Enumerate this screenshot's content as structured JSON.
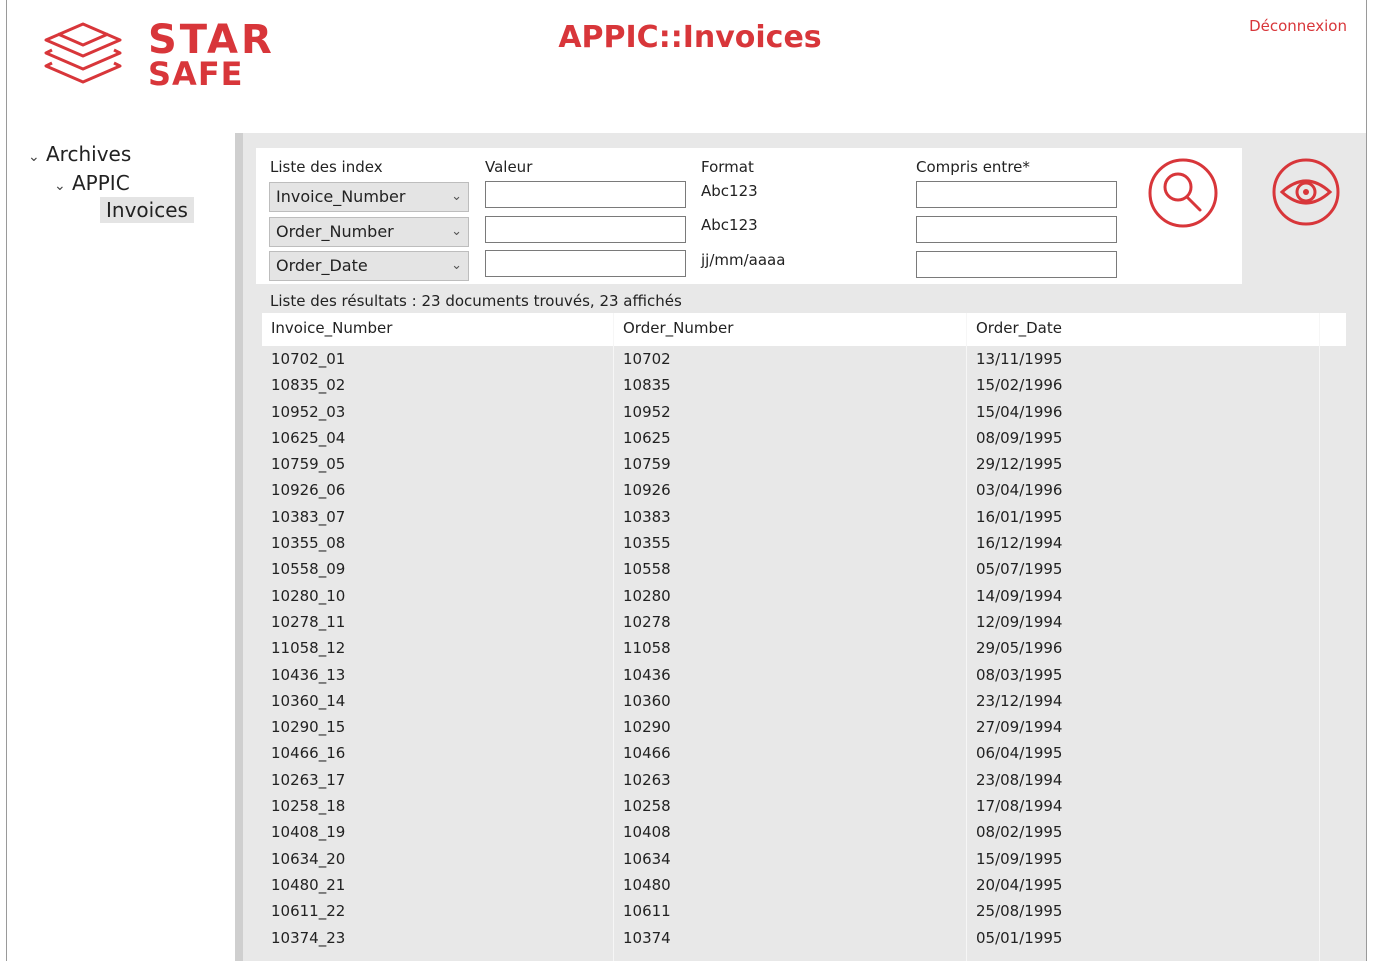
{
  "header": {
    "logo_line1": "STAR",
    "logo_line2": "SAFE",
    "title": "APPIC::Invoices",
    "logout_label": "Déconnexion"
  },
  "tree": {
    "root": "Archives",
    "child": "APPIC",
    "leaf": "Invoices"
  },
  "search": {
    "col_index_label": "Liste des index",
    "col_value_label": "Valeur",
    "col_format_label": "Format",
    "col_between_label": "Compris entre*",
    "rows": [
      {
        "index": "Invoice_Number",
        "format": "Abc123"
      },
      {
        "index": "Order_Number",
        "format": "Abc123"
      },
      {
        "index": "Order_Date",
        "format": "jj/mm/aaaa"
      }
    ],
    "search_icon": "magnifier-icon",
    "view_icon": "eye-icon"
  },
  "results": {
    "summary": "Liste des résultats : 23 documents trouvés, 23 affichés",
    "columns": [
      "Invoice_Number",
      "Order_Number",
      "Order_Date"
    ],
    "rows": [
      [
        "10702_01",
        "10702",
        "13/11/1995"
      ],
      [
        "10835_02",
        "10835",
        "15/02/1996"
      ],
      [
        "10952_03",
        "10952",
        "15/04/1996"
      ],
      [
        "10625_04",
        "10625",
        "08/09/1995"
      ],
      [
        "10759_05",
        "10759",
        "29/12/1995"
      ],
      [
        "10926_06",
        "10926",
        "03/04/1996"
      ],
      [
        "10383_07",
        "10383",
        "16/01/1995"
      ],
      [
        "10355_08",
        "10355",
        "16/12/1994"
      ],
      [
        "10558_09",
        "10558",
        "05/07/1995"
      ],
      [
        "10280_10",
        "10280",
        "14/09/1994"
      ],
      [
        "10278_11",
        "10278",
        "12/09/1994"
      ],
      [
        "11058_12",
        "11058",
        "29/05/1996"
      ],
      [
        "10436_13",
        "10436",
        "08/03/1995"
      ],
      [
        "10360_14",
        "10360",
        "23/12/1994"
      ],
      [
        "10290_15",
        "10290",
        "27/09/1994"
      ],
      [
        "10466_16",
        "10466",
        "06/04/1995"
      ],
      [
        "10263_17",
        "10263",
        "23/08/1994"
      ],
      [
        "10258_18",
        "10258",
        "17/08/1994"
      ],
      [
        "10408_19",
        "10408",
        "08/02/1995"
      ],
      [
        "10634_20",
        "10634",
        "15/09/1995"
      ],
      [
        "10480_21",
        "10480",
        "20/04/1995"
      ],
      [
        "10611_22",
        "10611",
        "25/08/1995"
      ],
      [
        "10374_23",
        "10374",
        "05/01/1995"
      ]
    ]
  },
  "colors": {
    "brand_red": "#d8363a",
    "panel_gray": "#e8e8e8"
  }
}
